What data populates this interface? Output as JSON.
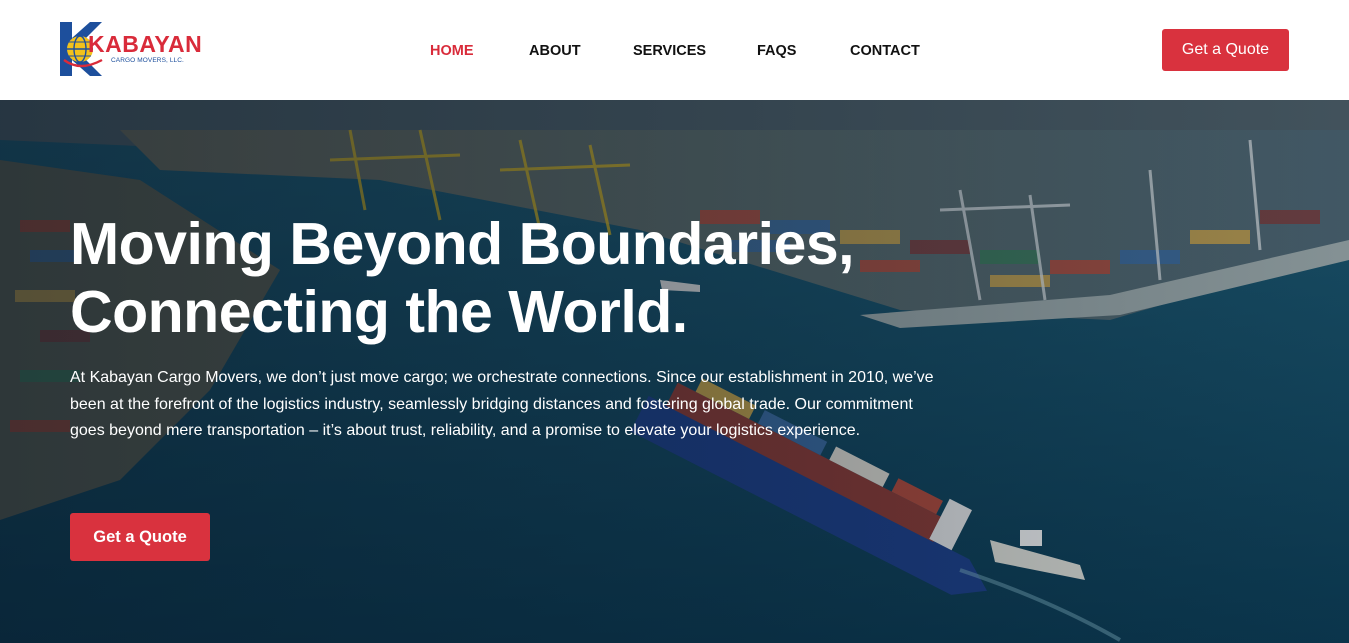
{
  "brand": {
    "name": "KABAYAN",
    "tagline": "CARGO MOVERS, LLC."
  },
  "nav": {
    "items": [
      {
        "label": "HOME",
        "active": true
      },
      {
        "label": "ABOUT",
        "active": false
      },
      {
        "label": "SERVICES",
        "active": false
      },
      {
        "label": "FAQS",
        "active": false
      },
      {
        "label": "CONTACT",
        "active": false
      }
    ],
    "cta_label": "Get a Quote"
  },
  "hero": {
    "title_line1": "Moving Beyond Boundaries,",
    "title_line2": "Connecting the World.",
    "description": "At Kabayan Cargo Movers, we don’t just move cargo; we orchestrate connections. Since our establishment in 2010, we’ve been at the forefront of the logistics industry, seamlessly bridging distances and fostering global trade. Our commitment goes beyond mere transportation – it’s about trust, reliability, and a promise to elevate your logistics experience.",
    "cta_label": "Get a Quote",
    "background": "aerial-port-cargo-ship-image"
  },
  "colors": {
    "accent": "#d9323e",
    "nav_text": "#111111",
    "header_bg": "#ffffff",
    "sea": "#0f4a63",
    "logo_blue": "#1d4f9c",
    "logo_yellow": "#f2c21b"
  }
}
